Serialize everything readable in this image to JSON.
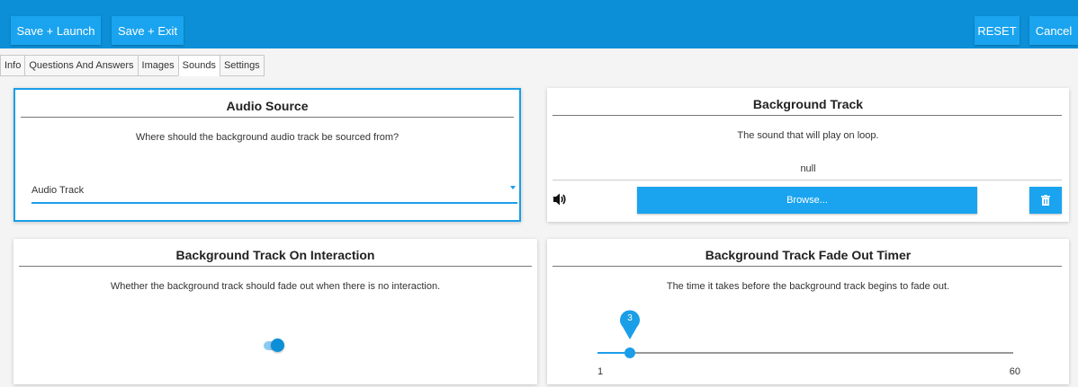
{
  "toolbar": {
    "save_launch_label": "Save + Launch",
    "save_exit_label": "Save + Exit",
    "reset_label": "RESET",
    "cancel_label": "Cancel"
  },
  "tabs": [
    {
      "label": "Info",
      "active": false
    },
    {
      "label": "Questions And Answers",
      "active": false
    },
    {
      "label": "Images",
      "active": false
    },
    {
      "label": "Sounds",
      "active": true
    },
    {
      "label": "Settings",
      "active": false
    }
  ],
  "audio_source": {
    "title": "Audio Source",
    "description": "Where should the background audio track be sourced from?",
    "selected": "Audio Track"
  },
  "background_track": {
    "title": "Background Track",
    "description": "The sound that will play on loop.",
    "value": "null",
    "browse_label": "Browse..."
  },
  "interaction": {
    "title": "Background Track On Interaction",
    "description": "Whether the background track should fade out when there is no interaction.",
    "enabled": true
  },
  "fade_timer": {
    "title": "Background Track Fade Out Timer",
    "description": "The time it takes before the background track begins to fade out.",
    "value": 3,
    "min": 1,
    "max": 60
  },
  "colors": {
    "accent": "#0c8fd6",
    "button": "#1aa4ef"
  },
  "icons": [
    "speaker-icon",
    "trash-icon"
  ]
}
